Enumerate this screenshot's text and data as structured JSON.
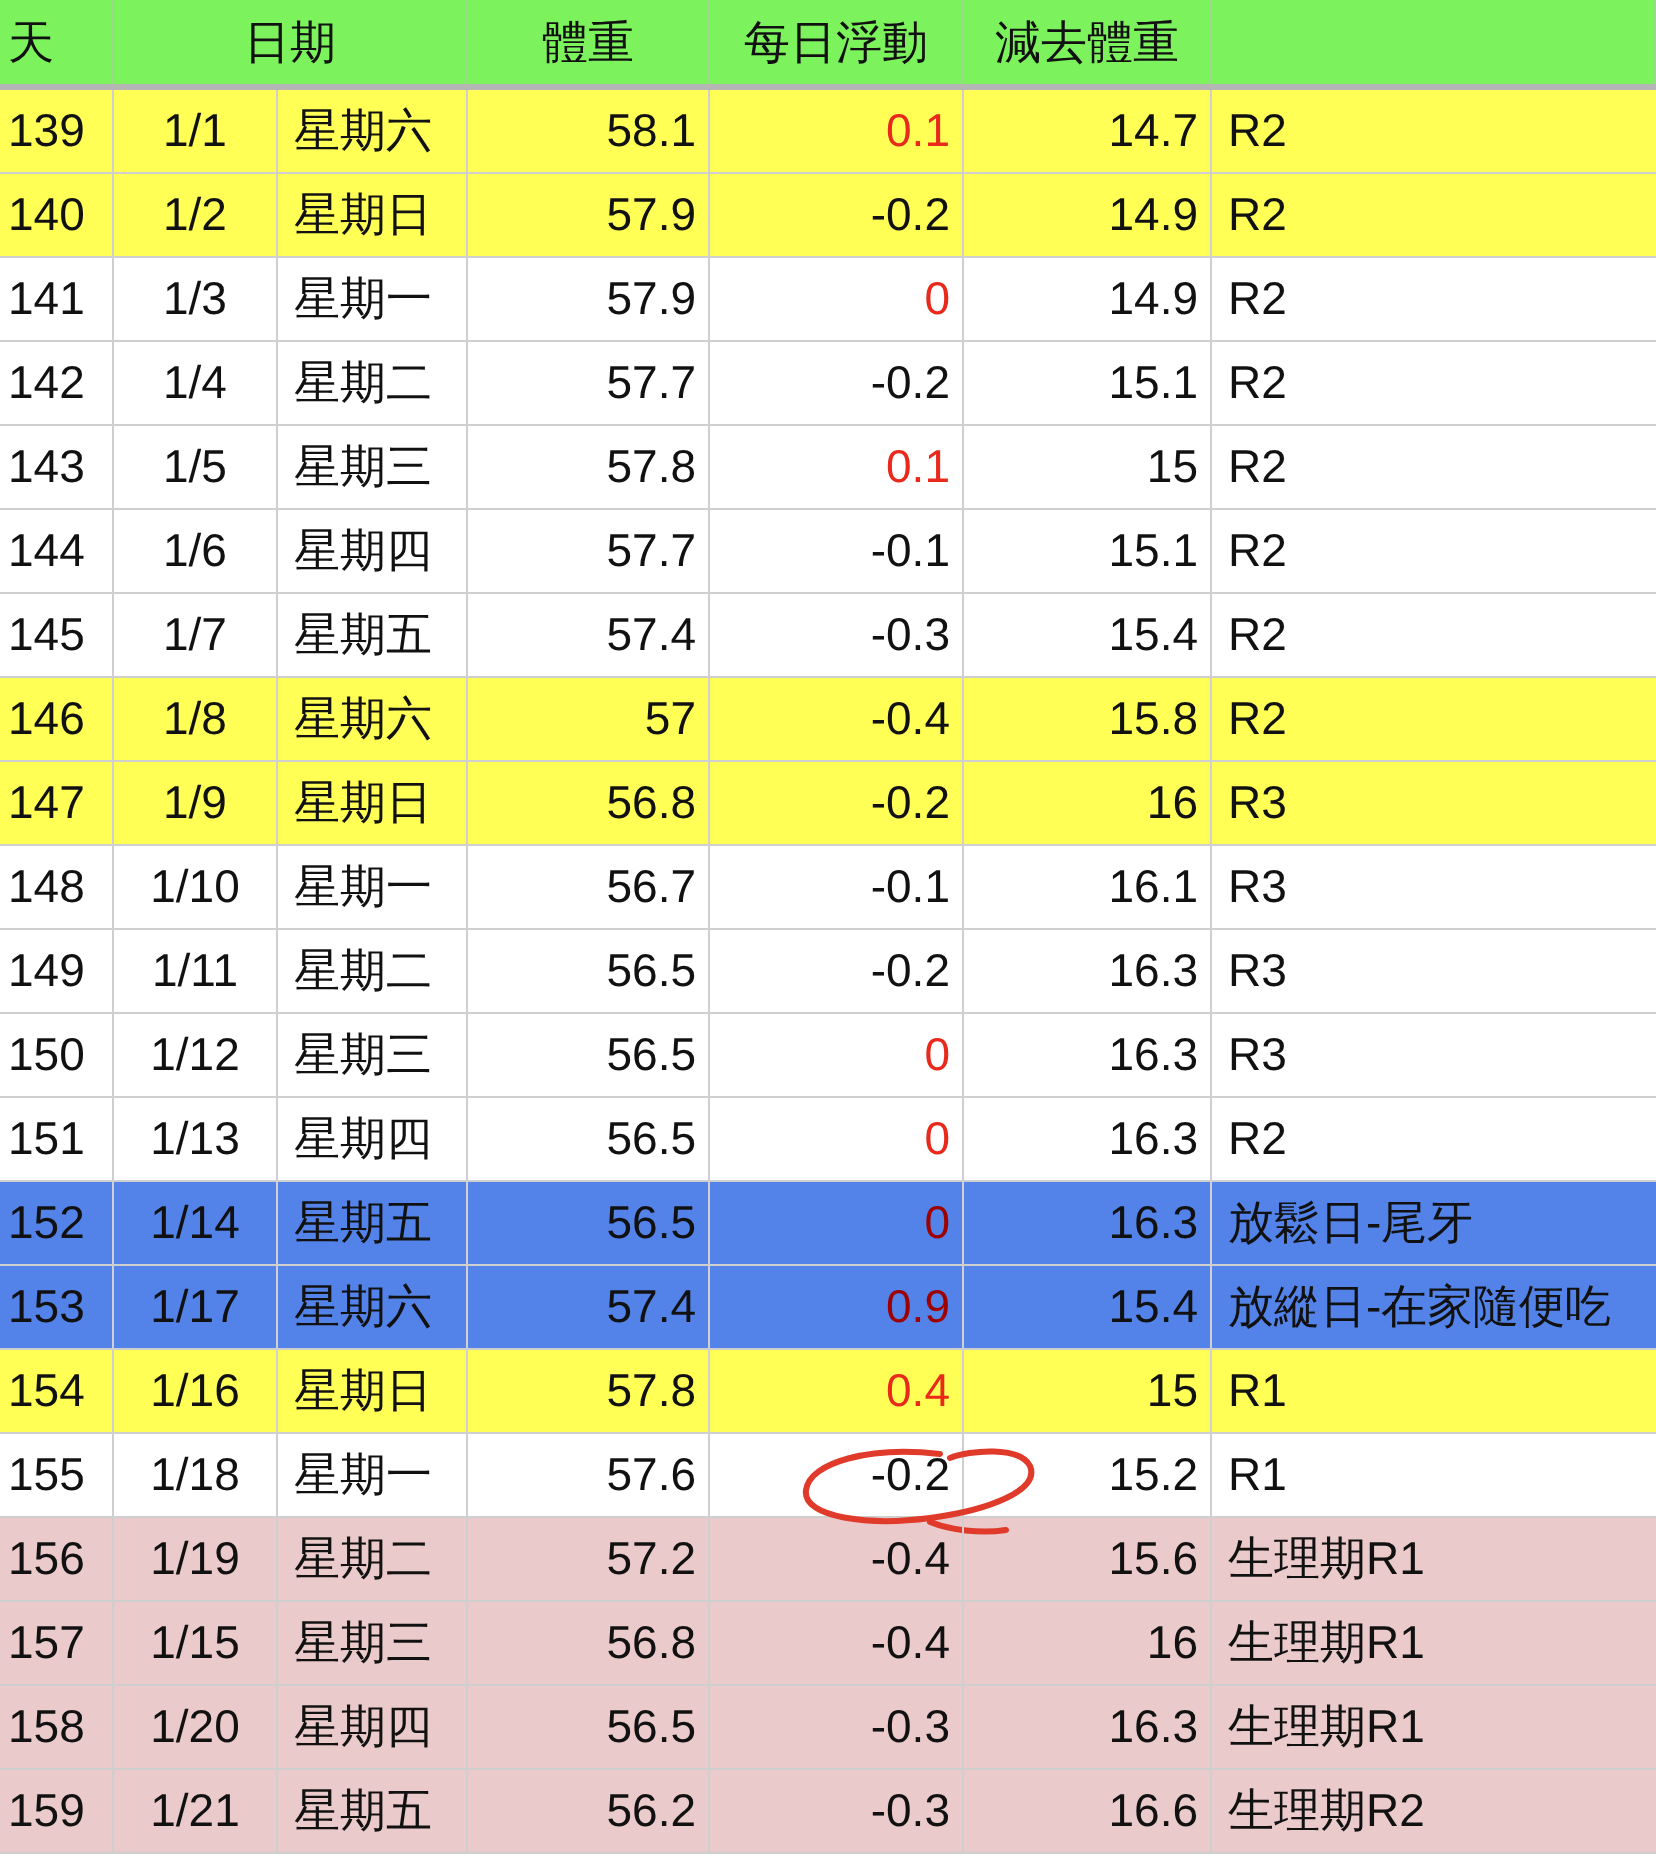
{
  "table": {
    "columns": [
      {
        "label": "天"
      },
      {
        "label": "日期"
      },
      {
        "label": "體重"
      },
      {
        "label": "每日浮動"
      },
      {
        "label": "減去體重"
      }
    ],
    "rows": [
      {
        "kind": "weekend",
        "day": "139",
        "date": "1/1",
        "weekday": "星期六",
        "weight": "58.1",
        "delta": "0.1",
        "delta_red": true,
        "lost": "14.7",
        "note": "R2"
      },
      {
        "kind": "weekend",
        "day": "140",
        "date": "1/2",
        "weekday": "星期日",
        "weight": "57.9",
        "delta": "-0.2",
        "delta_red": false,
        "lost": "14.9",
        "note": "R2"
      },
      {
        "kind": "normal",
        "day": "141",
        "date": "1/3",
        "weekday": "星期一",
        "weight": "57.9",
        "delta": "0",
        "delta_red": true,
        "lost": "14.9",
        "note": "R2"
      },
      {
        "kind": "normal",
        "day": "142",
        "date": "1/4",
        "weekday": "星期二",
        "weight": "57.7",
        "delta": "-0.2",
        "delta_red": false,
        "lost": "15.1",
        "note": "R2"
      },
      {
        "kind": "normal",
        "day": "143",
        "date": "1/5",
        "weekday": "星期三",
        "weight": "57.8",
        "delta": "0.1",
        "delta_red": true,
        "lost": "15",
        "note": "R2"
      },
      {
        "kind": "normal",
        "day": "144",
        "date": "1/6",
        "weekday": "星期四",
        "weight": "57.7",
        "delta": "-0.1",
        "delta_red": false,
        "lost": "15.1",
        "note": "R2"
      },
      {
        "kind": "normal",
        "day": "145",
        "date": "1/7",
        "weekday": "星期五",
        "weight": "57.4",
        "delta": "-0.3",
        "delta_red": false,
        "lost": "15.4",
        "note": "R2"
      },
      {
        "kind": "weekend",
        "day": "146",
        "date": "1/8",
        "weekday": "星期六",
        "weight": "57",
        "delta": "-0.4",
        "delta_red": false,
        "lost": "15.8",
        "note": "R2"
      },
      {
        "kind": "weekend",
        "day": "147",
        "date": "1/9",
        "weekday": "星期日",
        "weight": "56.8",
        "delta": "-0.2",
        "delta_red": false,
        "lost": "16",
        "note": "R3"
      },
      {
        "kind": "normal",
        "day": "148",
        "date": "1/10",
        "weekday": "星期一",
        "weight": "56.7",
        "delta": "-0.1",
        "delta_red": false,
        "lost": "16.1",
        "note": "R3"
      },
      {
        "kind": "normal",
        "day": "149",
        "date": "1/11",
        "weekday": "星期二",
        "weight": "56.5",
        "delta": "-0.2",
        "delta_red": false,
        "lost": "16.3",
        "note": "R3"
      },
      {
        "kind": "normal",
        "day": "150",
        "date": "1/12",
        "weekday": "星期三",
        "weight": "56.5",
        "delta": "0",
        "delta_red": true,
        "lost": "16.3",
        "note": "R3"
      },
      {
        "kind": "normal",
        "day": "151",
        "date": "1/13",
        "weekday": "星期四",
        "weight": "56.5",
        "delta": "0",
        "delta_red": true,
        "lost": "16.3",
        "note": "R2"
      },
      {
        "kind": "cheat",
        "day": "152",
        "date": "1/14",
        "weekday": "星期五",
        "weight": "56.5",
        "delta": "0",
        "delta_red": true,
        "lost": "16.3",
        "note": "放鬆日-尾牙"
      },
      {
        "kind": "cheat",
        "day": "153",
        "date": "1/17",
        "weekday": "星期六",
        "weight": "57.4",
        "delta": "0.9",
        "delta_red": true,
        "lost": "15.4",
        "note": "放縱日-在家隨便吃"
      },
      {
        "kind": "weekend",
        "day": "154",
        "date": "1/16",
        "weekday": "星期日",
        "weight": "57.8",
        "delta": "0.4",
        "delta_red": true,
        "lost": "15",
        "note": "R1"
      },
      {
        "kind": "normal",
        "day": "155",
        "date": "1/18",
        "weekday": "星期一",
        "weight": "57.6",
        "delta": "-0.2",
        "delta_red": false,
        "circled": true,
        "lost": "15.2",
        "note": "R1"
      },
      {
        "kind": "period",
        "day": "156",
        "date": "1/19",
        "weekday": "星期二",
        "weight": "57.2",
        "delta": "-0.4",
        "delta_red": false,
        "lost": "15.6",
        "note": "生理期R1"
      },
      {
        "kind": "period",
        "day": "157",
        "date": "1/15",
        "weekday": "星期三",
        "weight": "56.8",
        "delta": "-0.4",
        "delta_red": false,
        "lost": "16",
        "note": "生理期R1"
      },
      {
        "kind": "period",
        "day": "158",
        "date": "1/20",
        "weekday": "星期四",
        "weight": "56.5",
        "delta": "-0.3",
        "delta_red": false,
        "lost": "16.3",
        "note": "生理期R1"
      },
      {
        "kind": "period",
        "day": "159",
        "date": "1/21",
        "weekday": "星期五",
        "weight": "56.2",
        "delta": "-0.3",
        "delta_red": false,
        "lost": "16.6",
        "note": "生理期R2"
      }
    ]
  }
}
